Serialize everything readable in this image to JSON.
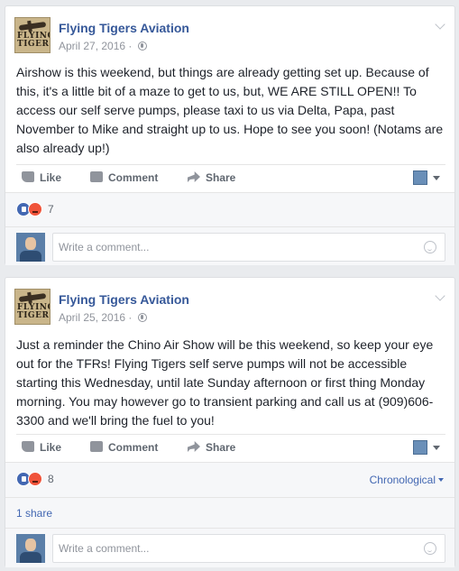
{
  "posts": [
    {
      "page_name": "Flying Tigers Aviation",
      "avatar_logo": "FLYING TIGERS",
      "date": "April 27, 2016",
      "privacy_icon": "globe-icon",
      "text": "Airshow is this weekend, but things are already getting set up. Because of this, it's a little bit of a maze to get to us, but, WE ARE STILL OPEN!! To access our self serve pumps, please taxi to us via Delta, Papa, past November to Mike and straight up to us. Hope to see you soon! (Notams are also already up!)",
      "actions": {
        "like": "Like",
        "comment": "Comment",
        "share": "Share"
      },
      "reaction_count": "7",
      "comment_placeholder": "Write a comment..."
    },
    {
      "page_name": "Flying Tigers Aviation",
      "avatar_logo": "FLYING TIGERS",
      "date": "April 25, 2016",
      "privacy_icon": "globe-icon",
      "text": "Just a reminder the Chino Air Show will be this weekend, so keep your eye out for the TFRs! Flying Tigers self serve pumps will not be accessible starting this Wednesday, until late Sunday afternoon or first thing Monday morning. You may however go to transient parking and call us at (909)606-3300 and we'll bring the fuel to you!",
      "actions": {
        "like": "Like",
        "comment": "Comment",
        "share": "Share"
      },
      "reaction_count": "8",
      "comment_sort": "Chronological",
      "shares": "1 share",
      "comment_placeholder": "Write a comment..."
    }
  ],
  "colors": {
    "link": "#365899",
    "accent": "#4267b2",
    "muted": "#90949c",
    "background": "#e9ebee"
  }
}
